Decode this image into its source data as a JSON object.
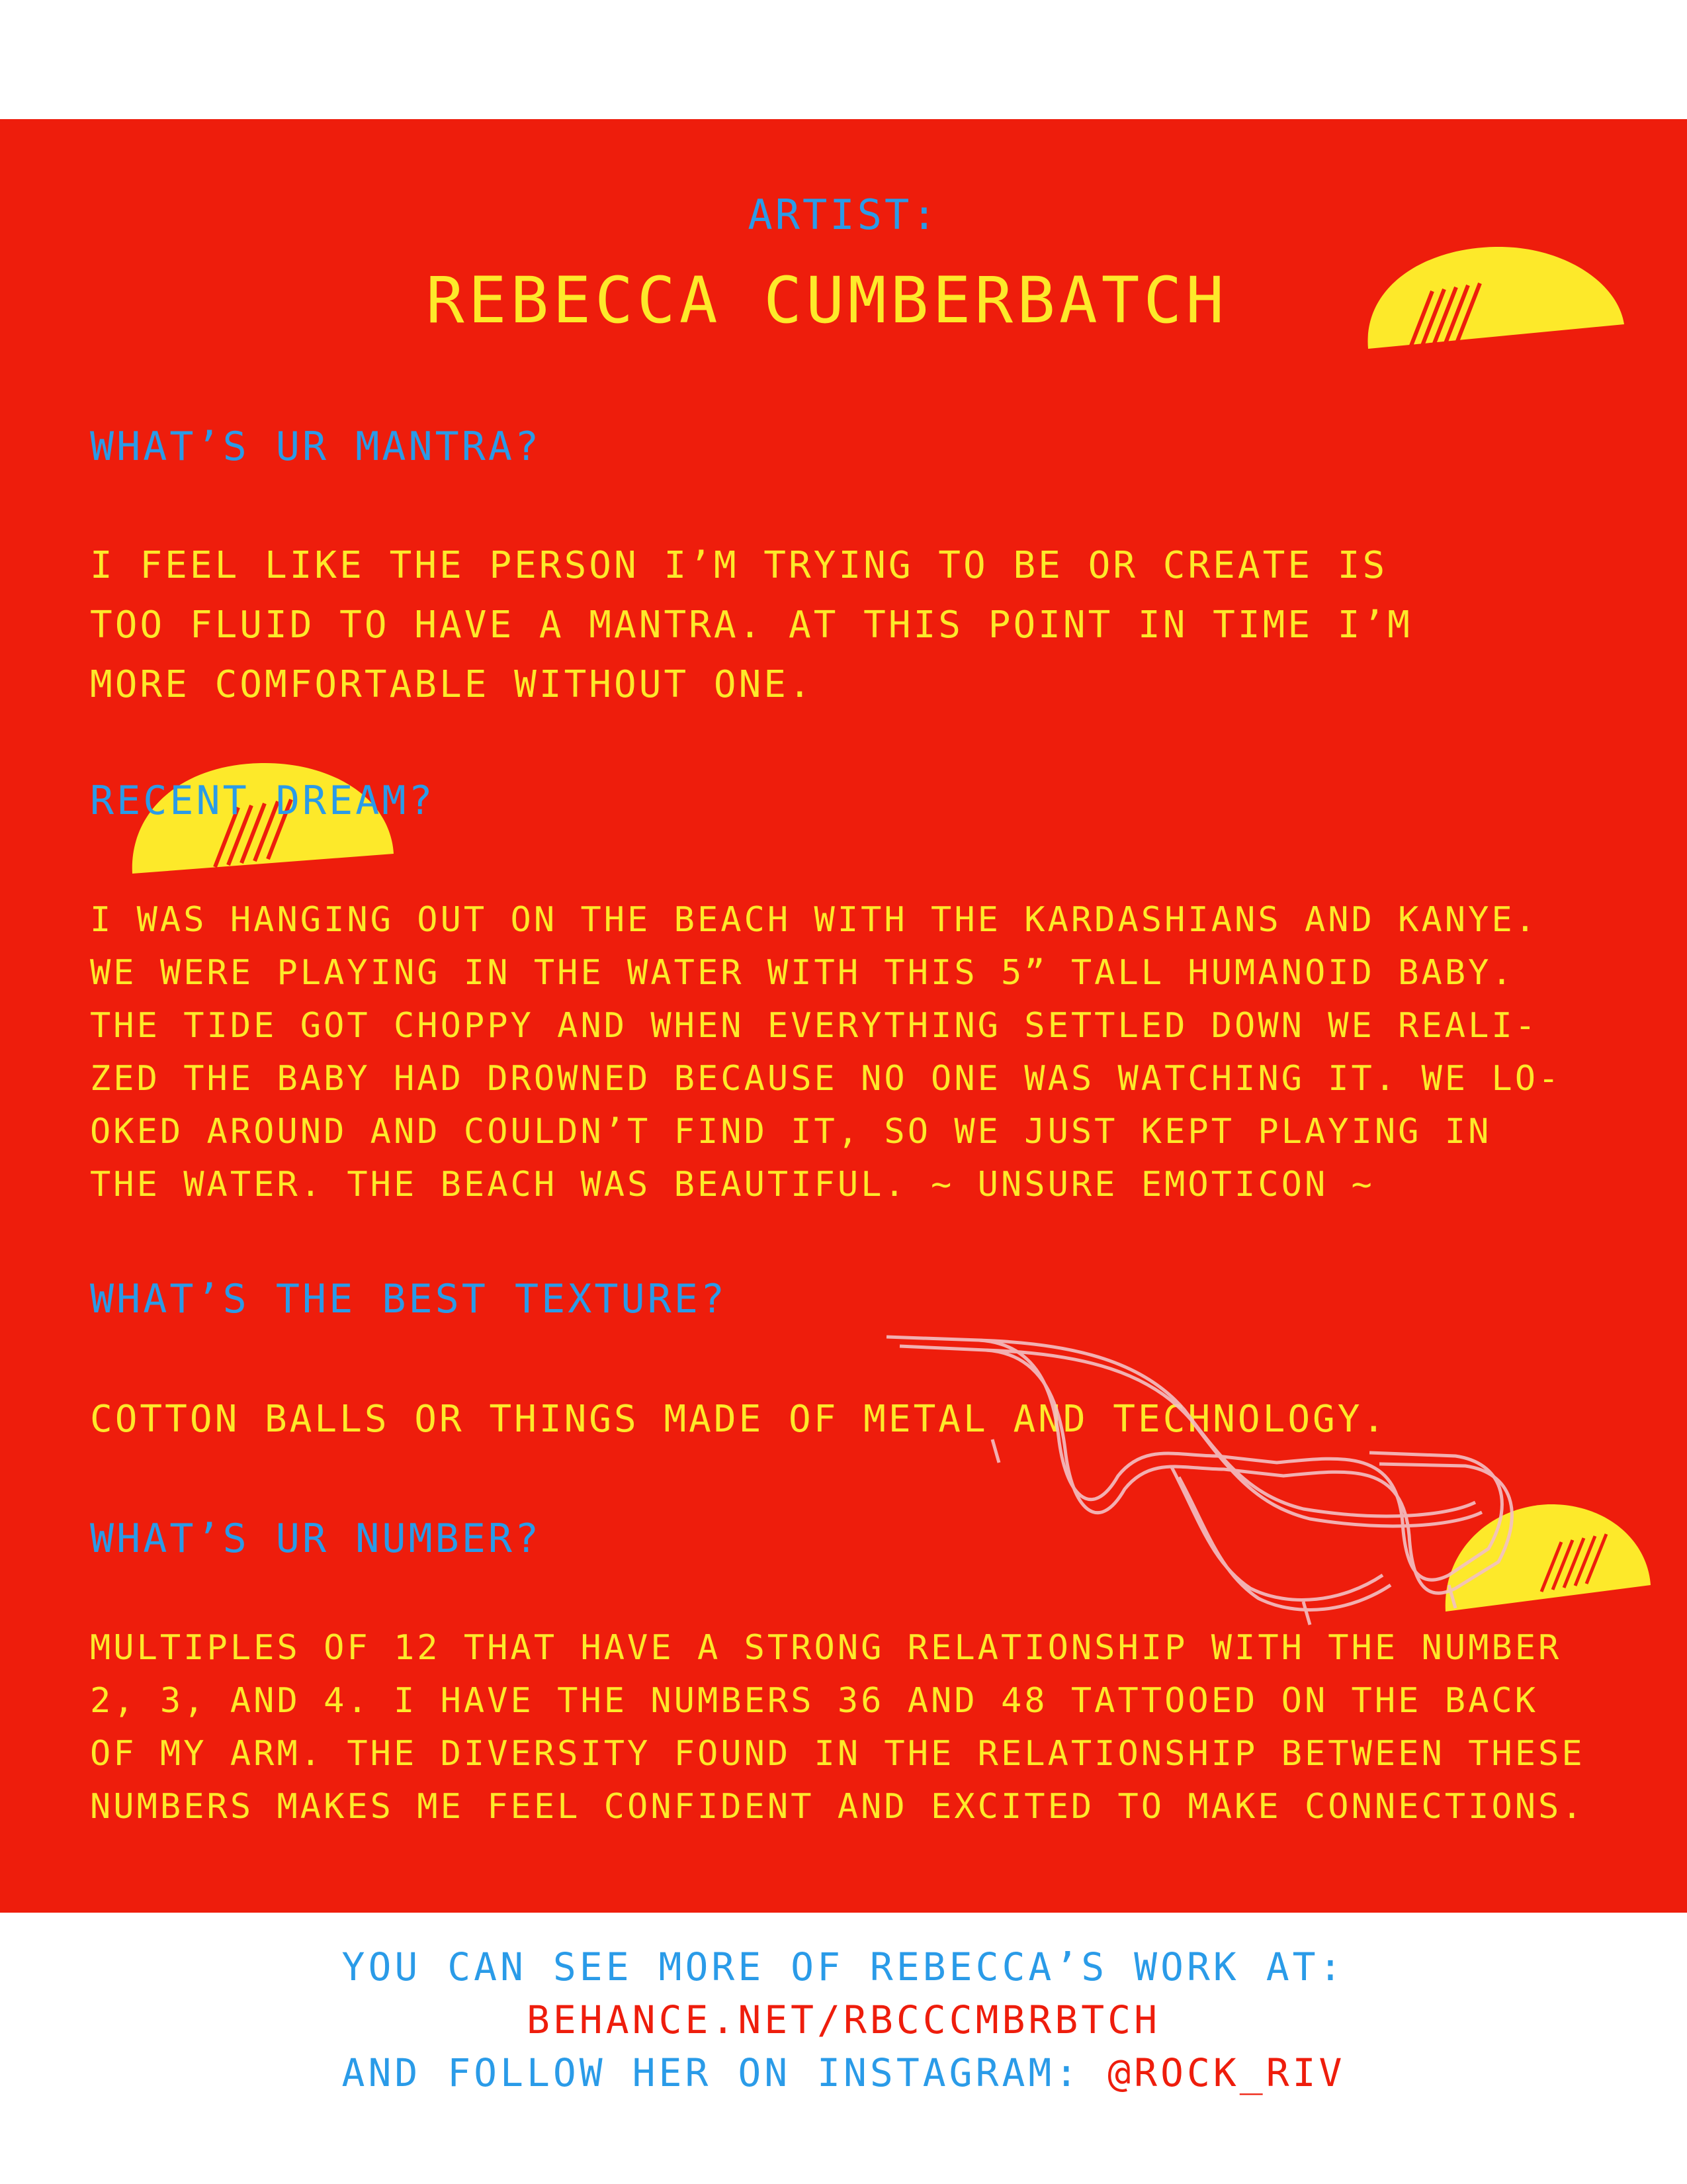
{
  "header": {
    "label": "ARTIST:",
    "name": "REBECCA CUMBERBATCH"
  },
  "sections": [
    {
      "question": "WHAT’S UR MANTRA?",
      "answer": "I FEEL LIKE THE PERSON I’M TRYING TO BE OR CREATE IS\nTOO FLUID TO HAVE A MANTRA. AT THIS POINT IN TIME I’M\nMORE COMFORTABLE WITHOUT ONE."
    },
    {
      "question": "RECENT DREAM?",
      "answer": "I WAS HANGING OUT ON THE BEACH WITH THE KARDASHIANS AND KANYE.\nWE WERE PLAYING IN THE WATER WITH THIS 5” TALL HUMANOID BABY.\nTHE TIDE GOT CHOPPY AND WHEN EVERYTHING SETTLED DOWN WE REALI-\nZED THE BABY HAD DROWNED BECAUSE NO ONE WAS WATCHING IT. WE LO-\nOKED AROUND AND COULDN’T FIND IT, SO WE JUST KEPT PLAYING IN\nTHE WATER. THE BEACH WAS BEAUTIFUL. ~ UNSURE EMOTICON ~"
    },
    {
      "question": "WHAT’S THE BEST TEXTURE?",
      "answer": "COTTON BALLS OR THINGS MADE OF METAL AND TECHNOLOGY."
    },
    {
      "question": "WHAT’S UR NUMBER?",
      "answer": "MULTIPLES OF 12 THAT HAVE A STRONG RELATIONSHIP WITH THE NUMBER\n2, 3, AND 4. I HAVE THE NUMBERS 36 AND 48 TATTOOED ON THE BACK\nOF MY ARM. THE DIVERSITY FOUND IN THE RELATIONSHIP BETWEEN THESE\nNUMBERS MAKES ME FEEL CONFIDENT AND EXCITED TO MAKE CONNECTIONS."
    }
  ],
  "footer": {
    "line1": "YOU CAN SEE MORE OF REBECCA’S WORK AT:",
    "link": "BEHANCE.NET/RBCCCMBRBTCH",
    "line3_prefix": "AND FOLLOW HER ON INSTAGRAM: ",
    "instagram": "@ROCK_RIV"
  },
  "colors": {
    "background": "#ee1d0c",
    "question": "#2a9be8",
    "answer": "#fde92a",
    "page": "#ffffff"
  },
  "icons": [
    "half-sun-icon",
    "lounge-chair-icon"
  ]
}
